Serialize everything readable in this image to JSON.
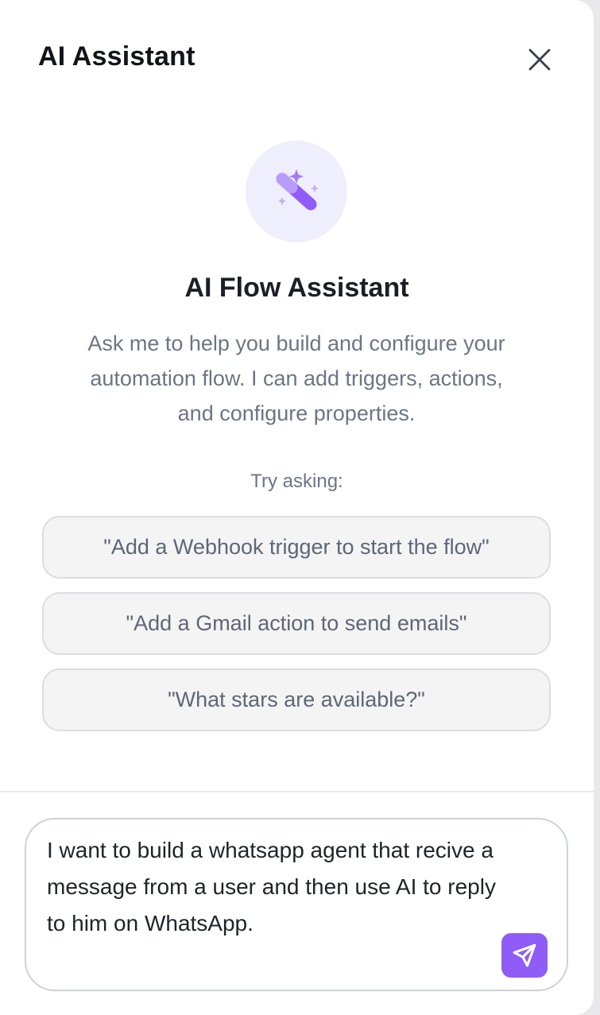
{
  "header": {
    "title": "AI Assistant",
    "close_icon": "close-icon"
  },
  "hero": {
    "icon": "magic-wand-icon",
    "title": "AI Flow Assistant",
    "description": "Ask me to help you build and configure your automation flow. I can add triggers, actions, and configure properties."
  },
  "suggestions": {
    "label": "Try asking:",
    "items": [
      "\"Add a Webhook trigger to start the flow\"",
      "\"Add a Gmail action to send emails\"",
      "\"What stars are available?\""
    ]
  },
  "composer": {
    "value": "I want to build a whatsapp agent that recive a message from a user and then use AI to reply to him on WhatsApp.",
    "send_icon": "send-icon"
  },
  "colors": {
    "accent": "#8f5cf7",
    "hero_bg": "#efeefc",
    "text_primary": "#111418",
    "text_secondary": "#6b7684"
  }
}
